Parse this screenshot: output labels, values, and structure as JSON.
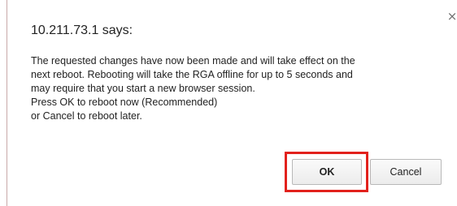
{
  "dialog": {
    "title": "10.211.73.1 says:",
    "close_symbol": "×",
    "message_lines": [
      "The requested changes have now been made and will take effect on the",
      "next reboot. Rebooting will take the RGA offline for up to 5 seconds and",
      "may require that you start a new browser session.",
      "Press OK to reboot now (Recommended)",
      "or Cancel to reboot later."
    ],
    "ok_label": "OK",
    "cancel_label": "Cancel"
  },
  "icons": {
    "close": "close-icon"
  },
  "colors": {
    "highlight_border": "#e2211c",
    "text": "#222222",
    "button_border": "#b9b9b9"
  }
}
